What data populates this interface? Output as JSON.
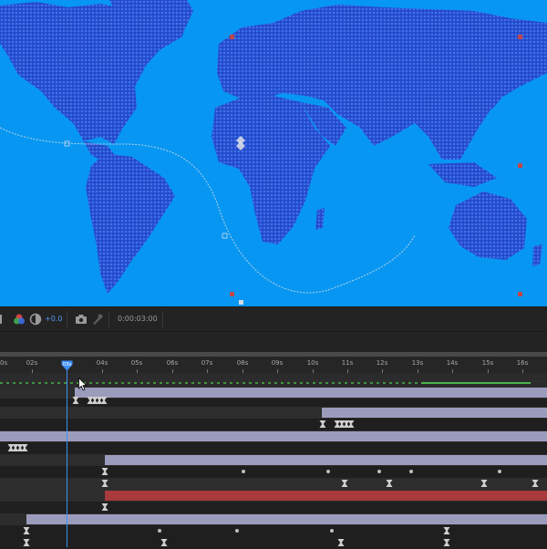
{
  "viewer": {
    "bg": "#0797f2",
    "land_color": "#2a52d8",
    "handle_color": "#c0464a",
    "icon": "layer-position-diamond-icon"
  },
  "toolbar": {
    "icons": [
      "grid-icon",
      "color-channels-icon",
      "exposure-icon",
      "snapshot-icon",
      "show-snapshot-icon"
    ],
    "exposure_value": "+0.0",
    "timecode": "0:00:03:00"
  },
  "timeline": {
    "ruler_labels": [
      "0s",
      "02s",
      "03s",
      "04s",
      "05s",
      "06s",
      "07s",
      "08s",
      "09s",
      "10s",
      "11s",
      "12s",
      "13s",
      "14s",
      "15s",
      "16s"
    ],
    "current_time_label": "03s",
    "playhead_color": "#3f8ff5",
    "layer_bar_color": "#9b9cbc",
    "selected_bar_color": "#a8393d"
  }
}
